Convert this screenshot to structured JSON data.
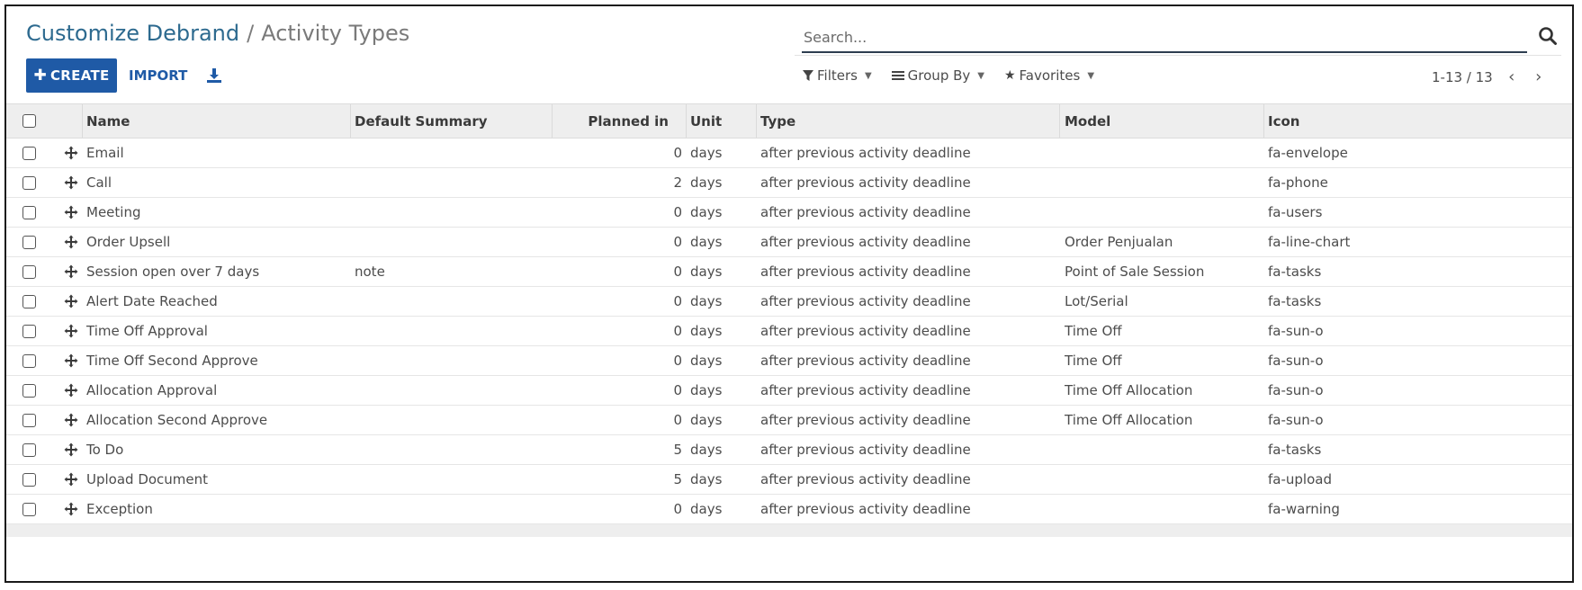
{
  "breadcrumb": {
    "parent": "Customize Debrand",
    "separator": "/",
    "current": "Activity Types"
  },
  "toolbar": {
    "create_label": "CREATE",
    "import_label": "IMPORT"
  },
  "search": {
    "placeholder": "Search..."
  },
  "filters": {
    "filters_label": "Filters",
    "groupby_label": "Group By",
    "favorites_label": "Favorites"
  },
  "pager": {
    "range": "1-13 / 13"
  },
  "table": {
    "headers": {
      "name": "Name",
      "default_summary": "Default Summary",
      "planned_in": "Planned in",
      "unit": "Unit",
      "type": "Type",
      "model": "Model",
      "icon": "Icon"
    },
    "rows": [
      {
        "name": "Email",
        "summary": "",
        "planned": "0",
        "unit": "days",
        "type": "after previous activity deadline",
        "model": "",
        "icon": "fa-envelope"
      },
      {
        "name": "Call",
        "summary": "",
        "planned": "2",
        "unit": "days",
        "type": "after previous activity deadline",
        "model": "",
        "icon": "fa-phone"
      },
      {
        "name": "Meeting",
        "summary": "",
        "planned": "0",
        "unit": "days",
        "type": "after previous activity deadline",
        "model": "",
        "icon": "fa-users"
      },
      {
        "name": "Order Upsell",
        "summary": "",
        "planned": "0",
        "unit": "days",
        "type": "after previous activity deadline",
        "model": "Order Penjualan",
        "icon": "fa-line-chart"
      },
      {
        "name": "Session open over 7 days",
        "summary": "note",
        "planned": "0",
        "unit": "days",
        "type": "after previous activity deadline",
        "model": "Point of Sale Session",
        "icon": "fa-tasks"
      },
      {
        "name": "Alert Date Reached",
        "summary": "",
        "planned": "0",
        "unit": "days",
        "type": "after previous activity deadline",
        "model": "Lot/Serial",
        "icon": "fa-tasks"
      },
      {
        "name": "Time Off Approval",
        "summary": "",
        "planned": "0",
        "unit": "days",
        "type": "after previous activity deadline",
        "model": "Time Off",
        "icon": "fa-sun-o"
      },
      {
        "name": "Time Off Second Approve",
        "summary": "",
        "planned": "0",
        "unit": "days",
        "type": "after previous activity deadline",
        "model": "Time Off",
        "icon": "fa-sun-o"
      },
      {
        "name": "Allocation Approval",
        "summary": "",
        "planned": "0",
        "unit": "days",
        "type": "after previous activity deadline",
        "model": "Time Off Allocation",
        "icon": "fa-sun-o"
      },
      {
        "name": "Allocation Second Approve",
        "summary": "",
        "planned": "0",
        "unit": "days",
        "type": "after previous activity deadline",
        "model": "Time Off Allocation",
        "icon": "fa-sun-o"
      },
      {
        "name": "To Do",
        "summary": "",
        "planned": "5",
        "unit": "days",
        "type": "after previous activity deadline",
        "model": "",
        "icon": "fa-tasks"
      },
      {
        "name": "Upload Document",
        "summary": "",
        "planned": "5",
        "unit": "days",
        "type": "after previous activity deadline",
        "model": "",
        "icon": "fa-upload"
      },
      {
        "name": "Exception",
        "summary": "",
        "planned": "0",
        "unit": "days",
        "type": "after previous activity deadline",
        "model": "",
        "icon": "fa-warning"
      }
    ]
  },
  "colors": {
    "primary": "#1f5aa6",
    "breadcrumb_link": "#2d6a8f",
    "header_bg": "#eeeeee"
  }
}
